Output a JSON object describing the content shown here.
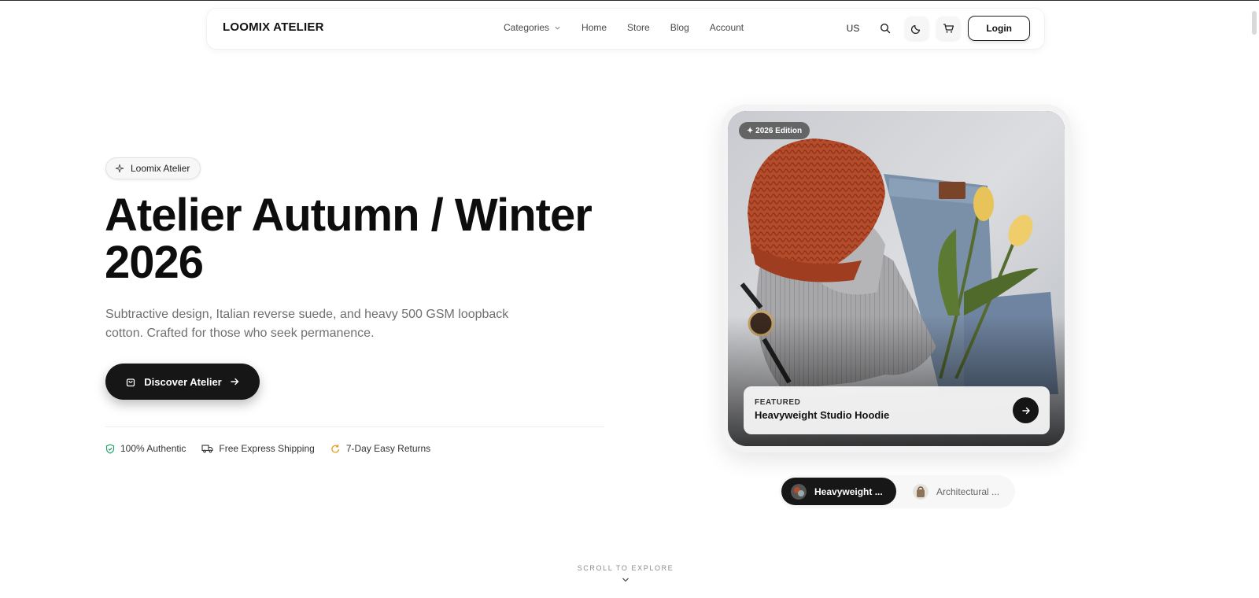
{
  "navbar": {
    "brand": "LOOMIX ATELIER",
    "links": [
      "Categories",
      "Home",
      "Store",
      "Blog",
      "Account"
    ],
    "locale": "US",
    "login_label": "Login",
    "icons": [
      "search-icon",
      "moon-icon",
      "cart-icon",
      "chevron-down-icon"
    ]
  },
  "hero": {
    "badge": "Loomix Atelier",
    "title_line1": "Atelier Autumn / Winter",
    "title_line2": "2026",
    "description": "Subtractive design, Italian reverse suede, and heavy 500 GSM loopback cotton. Crafted for those who seek permanence.",
    "cta_label": "Discover Atelier",
    "features": [
      {
        "label": "100% Authentic",
        "icon": "shield-check-icon",
        "color": "#22a06b"
      },
      {
        "label": "Free Express Shipping",
        "icon": "truck-icon",
        "color": "#333333"
      },
      {
        "label": "7-Day Easy Returns",
        "icon": "refresh-icon",
        "color": "#e0a020"
      }
    ]
  },
  "featured_card": {
    "edition_tag": "✦ 2026 Edition",
    "label": "FEATURED",
    "product_name": "Heavyweight Studio Hoodie"
  },
  "carousel": {
    "items": [
      {
        "label": "Heavyweight ...",
        "active": true
      },
      {
        "label": "Architectural ...",
        "active": false
      }
    ]
  },
  "scroll_hint": "SCROLL TO EXPLORE",
  "colors": {
    "primary_dark": "#161616",
    "background": "#ffffff",
    "muted_text": "#6f6f6f"
  }
}
